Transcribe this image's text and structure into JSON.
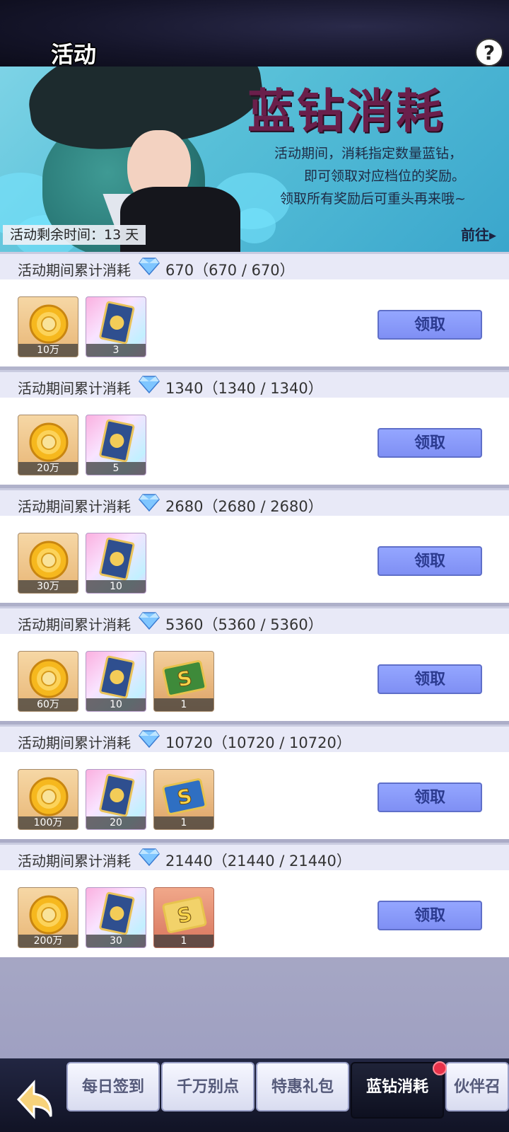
{
  "header": {
    "title": "活动",
    "help_glyph": "?"
  },
  "banner": {
    "title": "蓝钻消耗",
    "desc_lines": [
      "活动期间，消耗指定数量蓝钻，",
      "即可领取对应档位的奖励。",
      "领取所有奖励后可重头再来哦~"
    ],
    "remaining_label": "活动剩余时间：13 天",
    "goto_label": "前往▸"
  },
  "tiers": [
    {
      "label": "活动期间累计消耗",
      "amount": "670（670 / 670）",
      "rewards": [
        {
          "type": "gold",
          "icon": "coin-icon",
          "count": "10万"
        },
        {
          "type": "card",
          "icon": "card-icon",
          "count": "3"
        }
      ],
      "button": "领取"
    },
    {
      "label": "活动期间累计消耗",
      "amount": "1340（1340 / 1340）",
      "rewards": [
        {
          "type": "gold",
          "icon": "coin-icon",
          "count": "20万"
        },
        {
          "type": "card",
          "icon": "card-icon",
          "count": "5"
        }
      ],
      "button": "领取"
    },
    {
      "label": "活动期间累计消耗",
      "amount": "2680（2680 / 2680）",
      "rewards": [
        {
          "type": "gold",
          "icon": "coin-icon",
          "count": "30万"
        },
        {
          "type": "card",
          "icon": "card-icon",
          "count": "10"
        }
      ],
      "button": "领取"
    },
    {
      "label": "活动期间累计消耗",
      "amount": "5360（5360 / 5360）",
      "rewards": [
        {
          "type": "gold",
          "icon": "coin-icon",
          "count": "60万"
        },
        {
          "type": "card",
          "icon": "card-icon",
          "count": "10"
        },
        {
          "type": "green",
          "icon": "s-ticket-icon",
          "count": "1"
        }
      ],
      "button": "领取"
    },
    {
      "label": "活动期间累计消耗",
      "amount": "10720（10720 / 10720）",
      "rewards": [
        {
          "type": "gold",
          "icon": "coin-icon",
          "count": "100万"
        },
        {
          "type": "card",
          "icon": "card-icon",
          "count": "20"
        },
        {
          "type": "blue",
          "icon": "s-ticket-icon",
          "count": "1"
        }
      ],
      "button": "领取"
    },
    {
      "label": "活动期间累计消耗",
      "amount": "21440（21440 / 21440）",
      "rewards": [
        {
          "type": "gold",
          "icon": "coin-icon",
          "count": "200万"
        },
        {
          "type": "card",
          "icon": "card-icon",
          "count": "30"
        },
        {
          "type": "red",
          "icon": "s-ticket-icon",
          "count": "1"
        }
      ],
      "button": "领取"
    }
  ],
  "tabs": [
    {
      "label": "每日签到",
      "active": false
    },
    {
      "label": "千万别点",
      "active": false
    },
    {
      "label": "特惠礼包",
      "active": false
    },
    {
      "label": "蓝钻消耗",
      "active": true
    },
    {
      "label": "伙伴召",
      "active": false
    }
  ],
  "colors": {
    "accent": "#8797f7",
    "banner_title": "#6a1f4b",
    "row_header": "#e8e9f7",
    "notify_dot": "#e8324a"
  }
}
